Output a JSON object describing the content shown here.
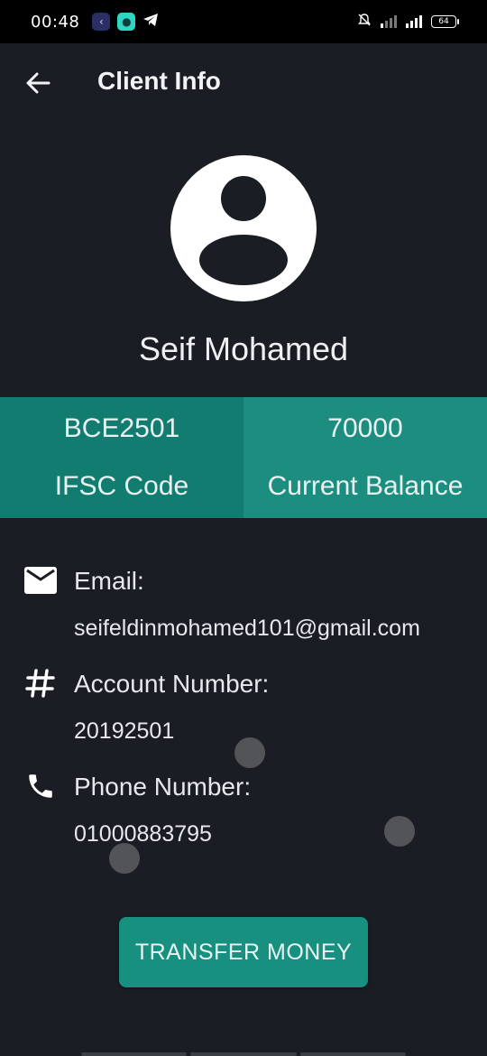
{
  "status_bar": {
    "time": "00:48",
    "battery": "64",
    "icons": [
      "back-app-icon",
      "chat-app-icon",
      "telegram-icon",
      "mute-bell-icon",
      "no-signal-icon",
      "signal-bars-icon",
      "battery-icon"
    ]
  },
  "app_bar": {
    "title": "Client Info",
    "back_icon": "arrow-left-icon"
  },
  "client": {
    "name": "Seif Mohamed",
    "avatar_icon": "account-avatar-icon"
  },
  "stats": {
    "ifsc_value": "BCE2501",
    "ifsc_label": "IFSC Code",
    "balance_value": "70000",
    "balance_label": "Current Balance"
  },
  "details": {
    "email_label": "Email:",
    "email_value": "seifeldinmohamed101@gmail.com",
    "account_label": "Account Number:",
    "account_value": "20192501",
    "phone_label": "Phone Number:",
    "phone_value": "01000883795"
  },
  "actions": {
    "transfer_label": "TRANSFER MONEY"
  },
  "colors": {
    "background": "#1a1e24",
    "accent": "#17907f",
    "stat_left": "#137c70",
    "stat_right": "#1d8d80"
  }
}
